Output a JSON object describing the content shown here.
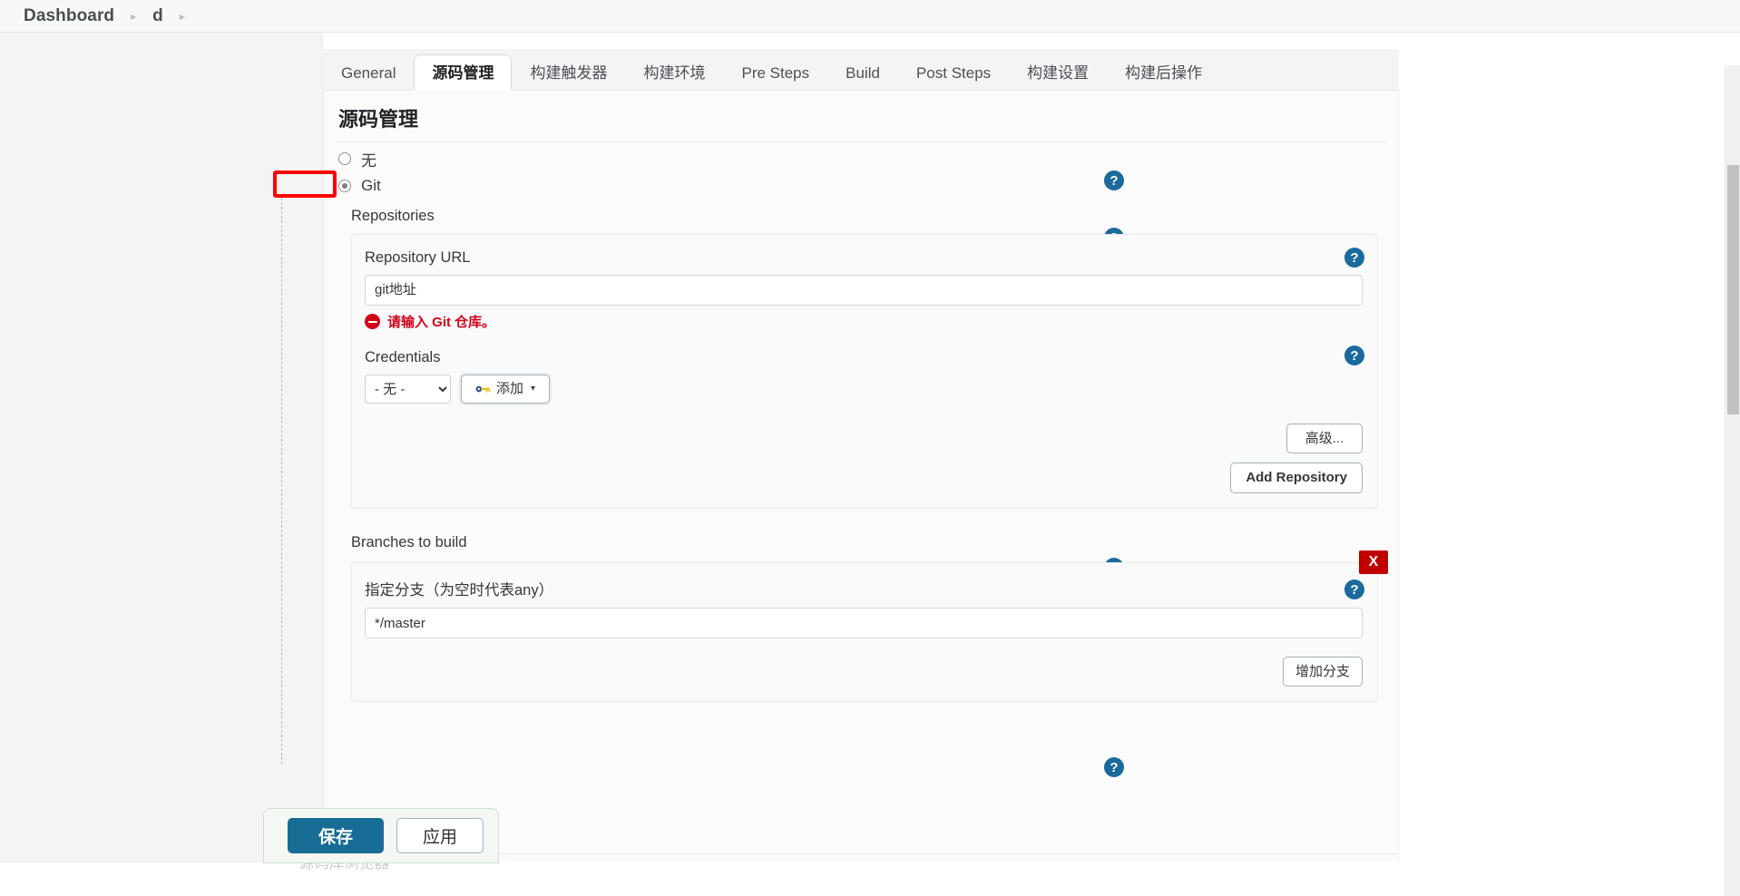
{
  "breadcrumb": {
    "items": [
      "Dashboard",
      "d"
    ],
    "separator": "▸"
  },
  "tabs": [
    {
      "label": "General",
      "active": false
    },
    {
      "label": "源码管理",
      "active": true
    },
    {
      "label": "构建触发器",
      "active": false
    },
    {
      "label": "构建环境",
      "active": false
    },
    {
      "label": "Pre Steps",
      "active": false
    },
    {
      "label": "Build",
      "active": false
    },
    {
      "label": "Post Steps",
      "active": false
    },
    {
      "label": "构建设置",
      "active": false
    },
    {
      "label": "构建后操作",
      "active": false
    }
  ],
  "section": {
    "title": "源码管理"
  },
  "scm": {
    "options": [
      {
        "label": "无",
        "checked": false
      },
      {
        "label": "Git",
        "checked": true
      }
    ]
  },
  "repositories": {
    "label": "Repositories",
    "url_label": "Repository URL",
    "url_value": "git地址",
    "url_placeholder": "",
    "error_text": "请输入 Git 仓库。",
    "credentials_label": "Credentials",
    "credentials_selected": "- 无 -",
    "credentials_options": [
      "- 无 -"
    ],
    "add_credentials_label": "添加",
    "advanced_label": "高级...",
    "add_repository_label": "Add Repository"
  },
  "branches": {
    "label": "Branches to build",
    "spec_label": "指定分支（为空时代表any）",
    "spec_value": "*/master",
    "delete_label": "X",
    "add_branch_label": "增加分支"
  },
  "browser": {
    "label": "源码库浏览器"
  },
  "footer": {
    "save_label": "保存",
    "apply_label": "应用"
  },
  "icons": {
    "help": "?"
  },
  "colors": {
    "accent_blue": "#176c96",
    "help_blue": "#1a6a9e",
    "error_red": "#d2021b",
    "annotation_red": "#ff0000",
    "delete_red": "#c00000"
  }
}
